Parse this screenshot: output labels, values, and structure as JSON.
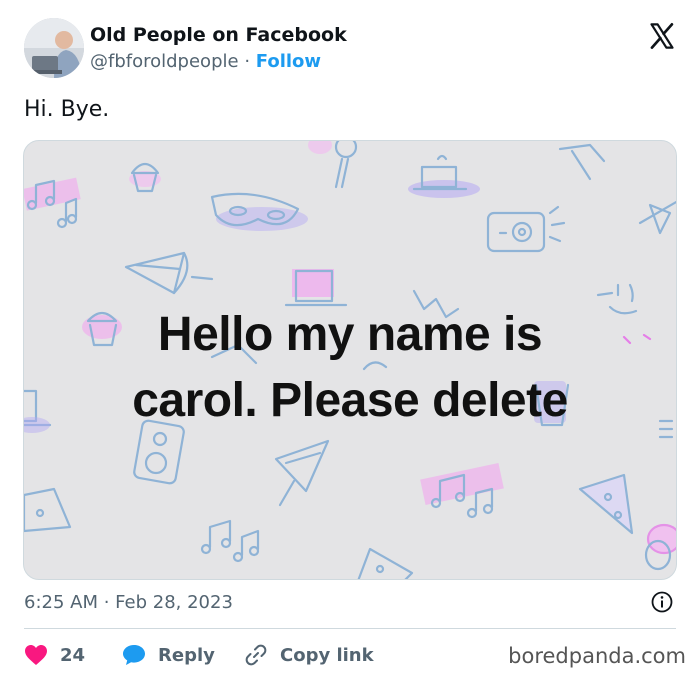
{
  "author": {
    "name": "Old People on Facebook",
    "handle": "@fbforoldpeople",
    "separator": "·",
    "follow_label": "Follow"
  },
  "tweet": {
    "text": "Hi. Bye.",
    "image_text_line1": "Hello my name is",
    "image_text_line2": "carol. Please delete",
    "timestamp": "6:25 AM · Feb 28, 2023"
  },
  "actions": {
    "like_count": "24",
    "reply_label": "Reply",
    "copy_label": "Copy link"
  },
  "watermark": "boredpanda.com",
  "icons": [
    "x-logo-icon",
    "info-icon",
    "heart-icon",
    "reply-bubble-icon",
    "link-icon"
  ],
  "colors": {
    "accent": "#1d9bf0",
    "like": "#f91880",
    "text": "#0f1419",
    "muted": "#536471",
    "image_bg": "#e4e4e6",
    "doodle_line": "#8fb3d6",
    "doodle_pink": "#e57ee8",
    "doodle_purple": "#a99cf0"
  }
}
